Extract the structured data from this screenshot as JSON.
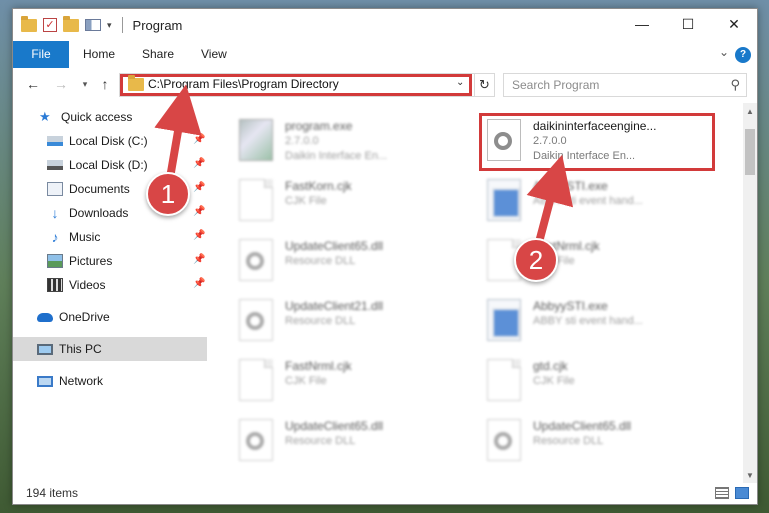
{
  "window": {
    "title": "Program",
    "controls": {
      "minimize": "—",
      "maximize": "☐",
      "close": "✕"
    }
  },
  "ribbon": {
    "tabs": [
      "File",
      "Home",
      "Share",
      "View"
    ],
    "help": "?"
  },
  "address": {
    "path": "C:\\Program Files\\Program Directory",
    "search_placeholder": "Search Program"
  },
  "sidebar": {
    "items": [
      {
        "label": "Quick access",
        "icon": "star-icon"
      },
      {
        "label": "Local Disk (C:)",
        "icon": "drive-icon"
      },
      {
        "label": "Local Disk (D:)",
        "icon": "drive-icon"
      },
      {
        "label": "Documents",
        "icon": "documents-icon"
      },
      {
        "label": "Downloads",
        "icon": "download-icon"
      },
      {
        "label": "Music",
        "icon": "music-icon"
      },
      {
        "label": "Pictures",
        "icon": "pictures-icon"
      },
      {
        "label": "Videos",
        "icon": "videos-icon"
      },
      {
        "label": "OneDrive",
        "icon": "cloud-icon"
      },
      {
        "label": "This PC",
        "icon": "computer-icon"
      },
      {
        "label": "Network",
        "icon": "network-icon"
      }
    ]
  },
  "files": [
    {
      "name": "program.exe",
      "line2": "2.7.0.0",
      "line3": "Daikin Interface En...",
      "icon": "program-icon"
    },
    {
      "name": "daikininterfaceengine...",
      "line2": "2.7.0.0",
      "line3": "Daikin Interface En...",
      "icon": "dll-gear-icon"
    },
    {
      "name": "FastKorn.cjk",
      "line2": "CJK File",
      "line3": "",
      "icon": "file-icon"
    },
    {
      "name": "AbbyySTI.exe",
      "line2": "ABBY sti event hand...",
      "line3": "",
      "icon": "exe-icon"
    },
    {
      "name": "UpdateClient65.dll",
      "line2": "Resource DLL",
      "line3": "",
      "icon": "dll-gear-icon"
    },
    {
      "name": "FastNrml.cjk",
      "line2": "CJK File",
      "line3": "",
      "icon": "file-icon"
    },
    {
      "name": "UpdateClient21.dll",
      "line2": "Resource DLL",
      "line3": "",
      "icon": "dll-gear-icon"
    },
    {
      "name": "AbbyySTI.exe",
      "line2": "ABBY sti event hand...",
      "line3": "",
      "icon": "exe-icon"
    },
    {
      "name": "FastNrml.cjk",
      "line2": "CJK File",
      "line3": "",
      "icon": "file-icon"
    },
    {
      "name": "gtd.cjk",
      "line2": "CJK File",
      "line3": "",
      "icon": "file-icon"
    },
    {
      "name": "UpdateClient65.dll",
      "line2": "Resource DLL",
      "line3": "",
      "icon": "dll-gear-icon"
    },
    {
      "name": "UpdateClient65.dll",
      "line2": "Resource DLL",
      "line3": "",
      "icon": "dll-gear-icon"
    }
  ],
  "status": {
    "item_count": "194 items"
  },
  "markers": [
    "1",
    "2"
  ],
  "colors": {
    "accent": "#1979ca",
    "highlight": "#d23a3a",
    "marker": "#d84646"
  }
}
